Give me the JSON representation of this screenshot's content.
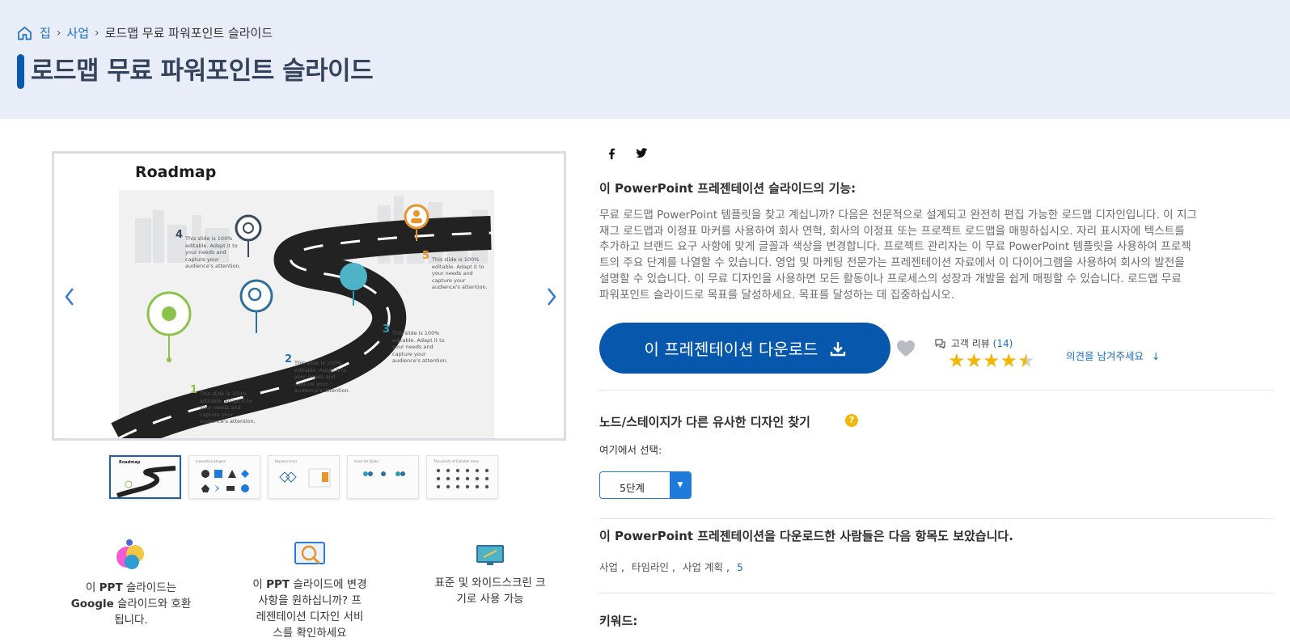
{
  "breadcrumb": {
    "home": "집",
    "category": "사업",
    "current": "로드맵 무료 파워포인트 슬라이드"
  },
  "page_title": "로드맵 무료 파워포인트 슬라이드",
  "preview": {
    "slide_title": "Roadmap",
    "milestones": [
      {
        "num": "1",
        "text": "This slide is 100% editable. Adapt it to your needs and capture your audience's attention.",
        "color": "#8bc34a"
      },
      {
        "num": "2",
        "text": "This slide is 100% editable. Adapt it to your needs and capture your audience's attention.",
        "color": "#2f6f9e"
      },
      {
        "num": "3",
        "text": "This slide is 100% editable. Adapt it to your needs and capture your audience's attention.",
        "color": "#2f9bb3"
      },
      {
        "num": "4",
        "text": "This slide is 100% editable. Adapt it to your needs and capture your audience's attention.",
        "color": "#3a4a5c"
      },
      {
        "num": "5",
        "text": "This slide is 100% editable. Adapt it to your needs and capture your audience's attention.",
        "color": "#e8932b"
      }
    ],
    "thumbnail_count": 5
  },
  "features": [
    {
      "html_parts": [
        "이 ",
        "PPT",
        " 슬라이드는 ",
        "Google",
        " 슬라이드와 호환됩니다."
      ]
    },
    {
      "html_parts": [
        "이 ",
        "PPT",
        " 슬라이드에 변경 사항을 원하십니까? 프레젠테이션 디자인 서비스를 확인하세요"
      ]
    },
    {
      "text": "표준 및 와이드스크린 크기로 사용 가능"
    }
  ],
  "features_text": {
    "f1a": "이 ",
    "f1b": "PPT",
    "f1c": " 슬라이드는",
    "f1d": "Google",
    "f1e": " 슬라이드와 호환",
    "f1f": "됩니다.",
    "f2a": "이 ",
    "f2b": "PPT",
    "f2c": " 슬라이드에 변경",
    "f2d": "사항을 원하십니까? 프",
    "f2e": "레젠테이션 디자인 서비",
    "f2f": "스를 확인하세요",
    "f3a": "표준 및 와이드스크린 크",
    "f3b": "기로 사용 가능"
  },
  "social": {
    "facebook": "f",
    "twitter": "twitter"
  },
  "features_heading": {
    "a": "이 ",
    "b": "PowerPoint",
    "c": " 프레젠테이션 슬라이드의 기능:"
  },
  "description_lines": [
    "무료 로드맵 PowerPoint 템플릿을 찾고 계십니까? 다음은 전문적으로 설계되고 완전히 편집 가능한 로드맵 디자인입니다. 이 지그",
    "재그 로드맵과 이정표 마커를 사용하여 회사 연혁, 회사의 이정표 또는 프로젝트 로드맵을 매핑하십시오. 자리 표시자에 텍스트를",
    "추가하고 브랜드 요구 사항에 맞게 글꼴과 색상을 변경합니다. 프로젝트 관리자는 이 무료 PowerPoint 템플릿을 사용하여 프로젝",
    "트의 주요 단계를 나열할 수 있습니다. 영업 및 마케팅 전문가는 프레젠테이션 자료에서 이 다이어그램을 사용하여 회사의 발전을",
    "설명할 수 있습니다. 이 무료 디자인을 사용하면 모든 활동이나 프로세스의 성장과 개발을 쉽게 매핑할 수 있습니다. 로드맵 무료",
    "파워포인트 슬라이드로 목표를 달성하세요. 목표를 달성하는 데 집중하십시오."
  ],
  "download_label": "이 프레젠테이션 다운로드",
  "reviews": {
    "label": "고객 리뷰",
    "count": "(14)",
    "rating": 4.5,
    "max": 5,
    "feedback": "의견을 남겨주세요"
  },
  "similar": {
    "heading": "노드/스테이지가 다른 유사한 디자인 찾기",
    "select_label": "여기에서 선택:",
    "selected": "5단계"
  },
  "also_viewed": {
    "a": "이 ",
    "b": "PowerPoint",
    "c": " 프레젠테이션을 다운로드한 사람들은 다음 항목도 보았습니다."
  },
  "tags": [
    "사업",
    "타임라인",
    "사업 계획",
    "5"
  ],
  "keywords_heading": "키워드:",
  "colors": {
    "accent": "#0757ad",
    "hero_bg": "#e9edf8",
    "star": "#f2b705",
    "link": "#1b6fc2"
  }
}
